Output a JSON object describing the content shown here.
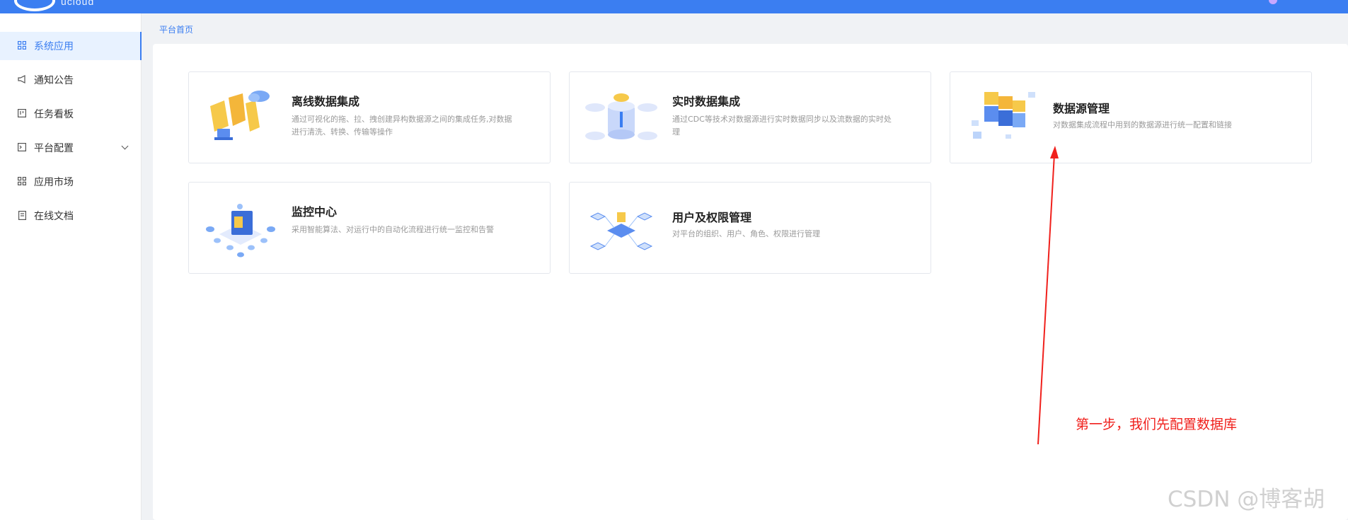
{
  "header": {
    "logo_text": "ucloud"
  },
  "sidebar": {
    "items": [
      {
        "label": "系统应用",
        "icon": "grid-icon"
      },
      {
        "label": "通知公告",
        "icon": "megaphone-icon"
      },
      {
        "label": "任务看板",
        "icon": "kanban-icon"
      },
      {
        "label": "平台配置",
        "icon": "terminal-icon"
      },
      {
        "label": "应用市场",
        "icon": "grid-icon"
      },
      {
        "label": "在线文档",
        "icon": "document-icon"
      }
    ]
  },
  "breadcrumb": {
    "label": "平台首页"
  },
  "cards": [
    {
      "title": "离线数据集成",
      "desc": "通过可视化的拖、拉、拽创建异构数据源之间的集成任务,对数据进行清洗、转换、传输等操作"
    },
    {
      "title": "实时数据集成",
      "desc": "通过CDC等技术对数据源进行实时数据同步以及流数据的实时处理"
    },
    {
      "title": "数据源管理",
      "desc": "对数据集成流程中用到的数据源进行统一配置和链接"
    },
    {
      "title": "监控中心",
      "desc": "采用智能算法、对运行中的自动化流程进行统一监控和告警"
    },
    {
      "title": "用户及权限管理",
      "desc": "对平台的组织、用户、角色、权限进行管理"
    }
  ],
  "annotation": {
    "text": "第一步，我们先配置数据库"
  },
  "watermark": {
    "text": "CSDN @博客胡"
  },
  "colors": {
    "primary": "#3b7ef1",
    "annotation": "#f0201c"
  }
}
